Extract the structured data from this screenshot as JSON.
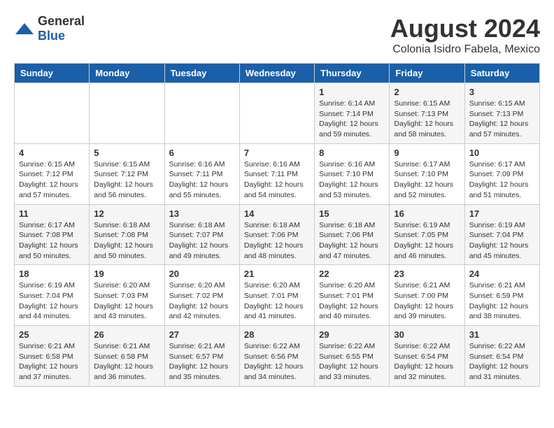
{
  "logo": {
    "general": "General",
    "blue": "Blue"
  },
  "header": {
    "month_year": "August 2024",
    "location": "Colonia Isidro Fabela, Mexico"
  },
  "days_of_week": [
    "Sunday",
    "Monday",
    "Tuesday",
    "Wednesday",
    "Thursday",
    "Friday",
    "Saturday"
  ],
  "weeks": [
    [
      {
        "day": "",
        "info": ""
      },
      {
        "day": "",
        "info": ""
      },
      {
        "day": "",
        "info": ""
      },
      {
        "day": "",
        "info": ""
      },
      {
        "day": "1",
        "info": "Sunrise: 6:14 AM\nSunset: 7:14 PM\nDaylight: 12 hours\nand 59 minutes."
      },
      {
        "day": "2",
        "info": "Sunrise: 6:15 AM\nSunset: 7:13 PM\nDaylight: 12 hours\nand 58 minutes."
      },
      {
        "day": "3",
        "info": "Sunrise: 6:15 AM\nSunset: 7:13 PM\nDaylight: 12 hours\nand 57 minutes."
      }
    ],
    [
      {
        "day": "4",
        "info": "Sunrise: 6:15 AM\nSunset: 7:12 PM\nDaylight: 12 hours\nand 57 minutes."
      },
      {
        "day": "5",
        "info": "Sunrise: 6:15 AM\nSunset: 7:12 PM\nDaylight: 12 hours\nand 56 minutes."
      },
      {
        "day": "6",
        "info": "Sunrise: 6:16 AM\nSunset: 7:11 PM\nDaylight: 12 hours\nand 55 minutes."
      },
      {
        "day": "7",
        "info": "Sunrise: 6:16 AM\nSunset: 7:11 PM\nDaylight: 12 hours\nand 54 minutes."
      },
      {
        "day": "8",
        "info": "Sunrise: 6:16 AM\nSunset: 7:10 PM\nDaylight: 12 hours\nand 53 minutes."
      },
      {
        "day": "9",
        "info": "Sunrise: 6:17 AM\nSunset: 7:10 PM\nDaylight: 12 hours\nand 52 minutes."
      },
      {
        "day": "10",
        "info": "Sunrise: 6:17 AM\nSunset: 7:09 PM\nDaylight: 12 hours\nand 51 minutes."
      }
    ],
    [
      {
        "day": "11",
        "info": "Sunrise: 6:17 AM\nSunset: 7:08 PM\nDaylight: 12 hours\nand 50 minutes."
      },
      {
        "day": "12",
        "info": "Sunrise: 6:18 AM\nSunset: 7:08 PM\nDaylight: 12 hours\nand 50 minutes."
      },
      {
        "day": "13",
        "info": "Sunrise: 6:18 AM\nSunset: 7:07 PM\nDaylight: 12 hours\nand 49 minutes."
      },
      {
        "day": "14",
        "info": "Sunrise: 6:18 AM\nSunset: 7:06 PM\nDaylight: 12 hours\nand 48 minutes."
      },
      {
        "day": "15",
        "info": "Sunrise: 6:18 AM\nSunset: 7:06 PM\nDaylight: 12 hours\nand 47 minutes."
      },
      {
        "day": "16",
        "info": "Sunrise: 6:19 AM\nSunset: 7:05 PM\nDaylight: 12 hours\nand 46 minutes."
      },
      {
        "day": "17",
        "info": "Sunrise: 6:19 AM\nSunset: 7:04 PM\nDaylight: 12 hours\nand 45 minutes."
      }
    ],
    [
      {
        "day": "18",
        "info": "Sunrise: 6:19 AM\nSunset: 7:04 PM\nDaylight: 12 hours\nand 44 minutes."
      },
      {
        "day": "19",
        "info": "Sunrise: 6:20 AM\nSunset: 7:03 PM\nDaylight: 12 hours\nand 43 minutes."
      },
      {
        "day": "20",
        "info": "Sunrise: 6:20 AM\nSunset: 7:02 PM\nDaylight: 12 hours\nand 42 minutes."
      },
      {
        "day": "21",
        "info": "Sunrise: 6:20 AM\nSunset: 7:01 PM\nDaylight: 12 hours\nand 41 minutes."
      },
      {
        "day": "22",
        "info": "Sunrise: 6:20 AM\nSunset: 7:01 PM\nDaylight: 12 hours\nand 40 minutes."
      },
      {
        "day": "23",
        "info": "Sunrise: 6:21 AM\nSunset: 7:00 PM\nDaylight: 12 hours\nand 39 minutes."
      },
      {
        "day": "24",
        "info": "Sunrise: 6:21 AM\nSunset: 6:59 PM\nDaylight: 12 hours\nand 38 minutes."
      }
    ],
    [
      {
        "day": "25",
        "info": "Sunrise: 6:21 AM\nSunset: 6:58 PM\nDaylight: 12 hours\nand 37 minutes."
      },
      {
        "day": "26",
        "info": "Sunrise: 6:21 AM\nSunset: 6:58 PM\nDaylight: 12 hours\nand 36 minutes."
      },
      {
        "day": "27",
        "info": "Sunrise: 6:21 AM\nSunset: 6:57 PM\nDaylight: 12 hours\nand 35 minutes."
      },
      {
        "day": "28",
        "info": "Sunrise: 6:22 AM\nSunset: 6:56 PM\nDaylight: 12 hours\nand 34 minutes."
      },
      {
        "day": "29",
        "info": "Sunrise: 6:22 AM\nSunset: 6:55 PM\nDaylight: 12 hours\nand 33 minutes."
      },
      {
        "day": "30",
        "info": "Sunrise: 6:22 AM\nSunset: 6:54 PM\nDaylight: 12 hours\nand 32 minutes."
      },
      {
        "day": "31",
        "info": "Sunrise: 6:22 AM\nSunset: 6:54 PM\nDaylight: 12 hours\nand 31 minutes."
      }
    ]
  ]
}
